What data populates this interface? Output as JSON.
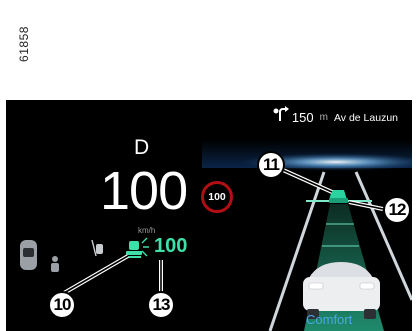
{
  "reference_code": "61858",
  "navigation": {
    "distance": "150",
    "distance_unit": "m",
    "street": "Av de Lauzun"
  },
  "cluster": {
    "gear": "D",
    "speed": "100",
    "speed_unit": "km/h",
    "speed_limit": "100",
    "acc_set_speed": "100",
    "driving_mode": "Comfort"
  },
  "callouts": {
    "c10": "10",
    "c11": "11",
    "c12": "12",
    "c13": "13"
  },
  "colors": {
    "acc_green": "#3de0a8",
    "mode_blue": "#4aa8e8",
    "limit_red": "#b20f14",
    "lane_green": "#1f8a6c"
  }
}
